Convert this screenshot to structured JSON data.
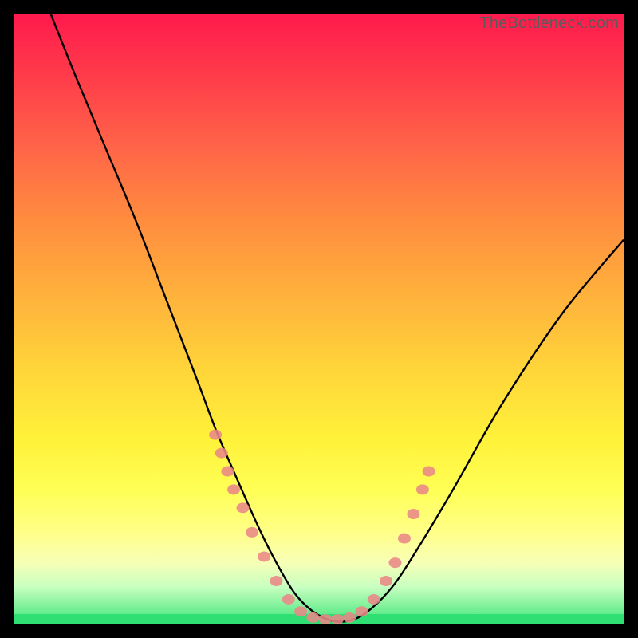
{
  "watermark": "TheBottleneck.com",
  "colors": {
    "frame": "#000000",
    "curve": "#000000",
    "marker_fill": "#e98787",
    "marker_stroke": "#d46e6e",
    "gradient_top": "#ff1a4d",
    "gradient_bottom": "#2fdf74"
  },
  "chart_data": {
    "type": "line",
    "title": "",
    "xlabel": "",
    "ylabel": "",
    "xlim": [
      0,
      100
    ],
    "ylim": [
      0,
      100
    ],
    "note": "Axes unlabeled; values are percent of plot area (0 at bottom/left, 100 at top/right). Curve is a V-shaped bottleneck curve; markers cluster near the valley.",
    "series": [
      {
        "name": "bottleneck-curve",
        "x": [
          6,
          10,
          15,
          20,
          25,
          30,
          33,
          36,
          40,
          43,
          46,
          49,
          52,
          55,
          58,
          62,
          66,
          72,
          80,
          90,
          100
        ],
        "y": [
          100,
          90,
          78,
          66,
          53,
          40,
          32,
          25,
          16,
          10,
          5,
          2,
          0.5,
          0.5,
          2,
          6,
          12,
          22,
          36,
          51,
          63
        ]
      }
    ],
    "markers": {
      "name": "sample-points",
      "points": [
        {
          "x": 33,
          "y": 31
        },
        {
          "x": 34,
          "y": 28
        },
        {
          "x": 35,
          "y": 25
        },
        {
          "x": 36,
          "y": 22
        },
        {
          "x": 37.5,
          "y": 19
        },
        {
          "x": 39,
          "y": 15
        },
        {
          "x": 41,
          "y": 11
        },
        {
          "x": 43,
          "y": 7
        },
        {
          "x": 45,
          "y": 4
        },
        {
          "x": 47,
          "y": 2
        },
        {
          "x": 49,
          "y": 1
        },
        {
          "x": 51,
          "y": 0.7
        },
        {
          "x": 53,
          "y": 0.7
        },
        {
          "x": 55,
          "y": 1
        },
        {
          "x": 57,
          "y": 2
        },
        {
          "x": 59,
          "y": 4
        },
        {
          "x": 61,
          "y": 7
        },
        {
          "x": 62.5,
          "y": 10
        },
        {
          "x": 64,
          "y": 14
        },
        {
          "x": 65.5,
          "y": 18
        },
        {
          "x": 67,
          "y": 22
        },
        {
          "x": 68,
          "y": 25
        }
      ]
    }
  }
}
